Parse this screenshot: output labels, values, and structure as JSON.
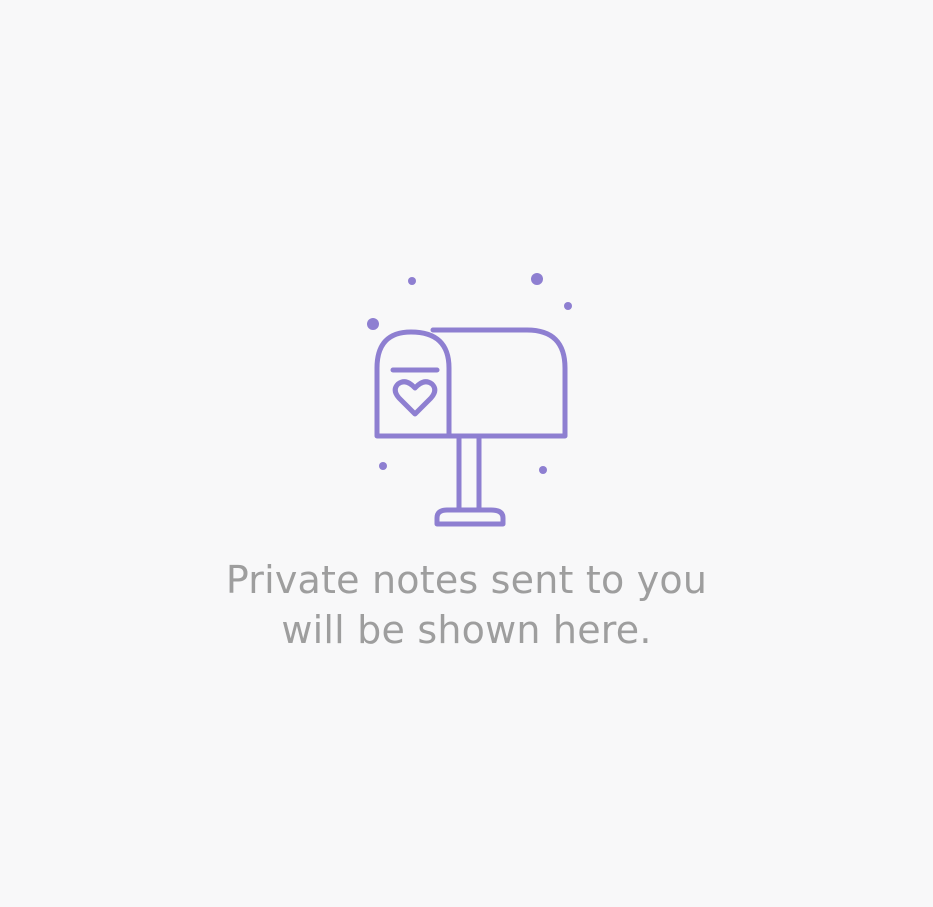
{
  "empty_state": {
    "icon": "mailbox-heart-icon",
    "accent_color": "#8e7fd1",
    "text_color": "#9e9e9e",
    "background_color": "#f8f8f9",
    "message_lines": [
      "Private notes sent to you",
      "will be shown here."
    ]
  }
}
